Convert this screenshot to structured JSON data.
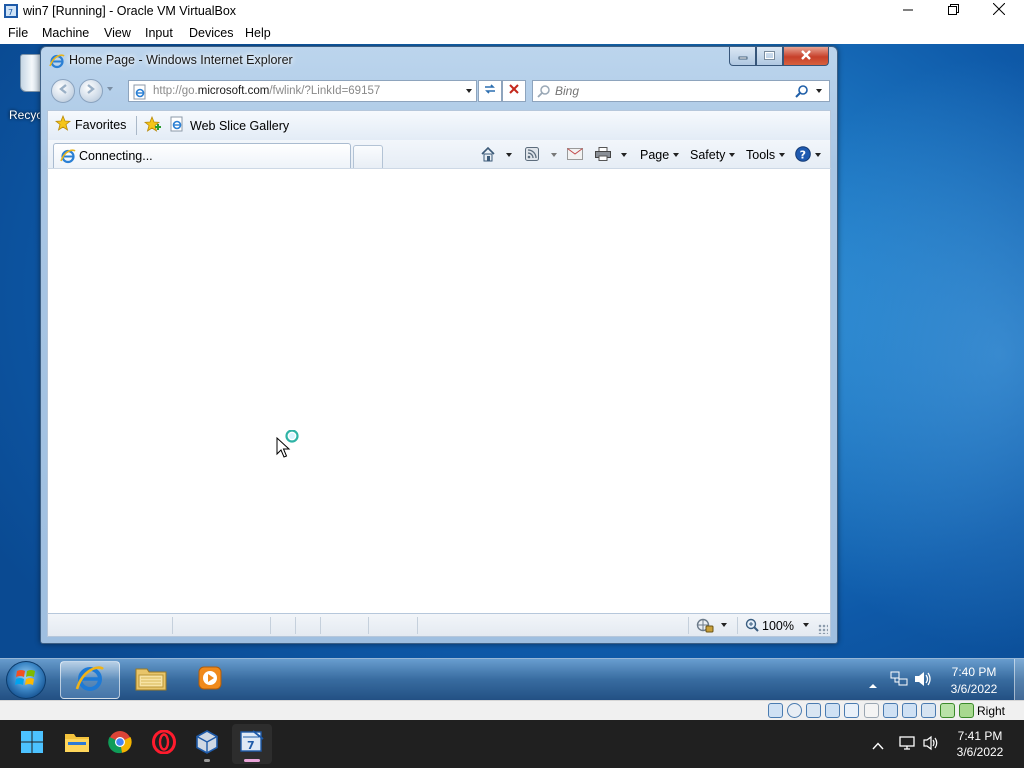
{
  "host_window": {
    "title": "win7 [Running] - Oracle VM VirtualBox",
    "menu": [
      "File",
      "Machine",
      "View",
      "Input",
      "Devices",
      "Help"
    ],
    "icons": [
      "virtualbox-icon",
      "minimize-icon",
      "maximize-icon",
      "close-icon"
    ]
  },
  "guest_desktop": {
    "recycle_bin_label": "Recyc"
  },
  "ie_window": {
    "title": "Home Page - Windows Internet Explorer",
    "address": {
      "prefix": "http://go.",
      "domain": "microsoft.com",
      "path": "/fwlink/?LinkId=69157"
    },
    "search_placeholder": "Bing",
    "favorites_label": "Favorites",
    "web_slice_label": "Web Slice Gallery",
    "tab_label": "Connecting...",
    "commands": {
      "page": "Page",
      "safety": "Safety",
      "tools": "Tools"
    },
    "zoom": "100%"
  },
  "guest_taskbar": {
    "pinned": [
      "internet-explorer",
      "windows-explorer",
      "media-player"
    ],
    "clock_time": "7:40 PM",
    "clock_date": "3/6/2022"
  },
  "vbox_status": {
    "host_key": "Right Ctrl"
  },
  "host_taskbar": {
    "apps": [
      "start",
      "file-explorer",
      "chrome",
      "opera",
      "virtualbox",
      "virtualbox-vm"
    ],
    "clock_time": "7:41 PM",
    "clock_date": "3/6/2022"
  },
  "colors": {
    "win7_desktop": "#1f7bc6",
    "ie_frame": "#a9c6e4",
    "win11_taskbar": "#202020",
    "active_indicator": "#e9a4d8"
  }
}
